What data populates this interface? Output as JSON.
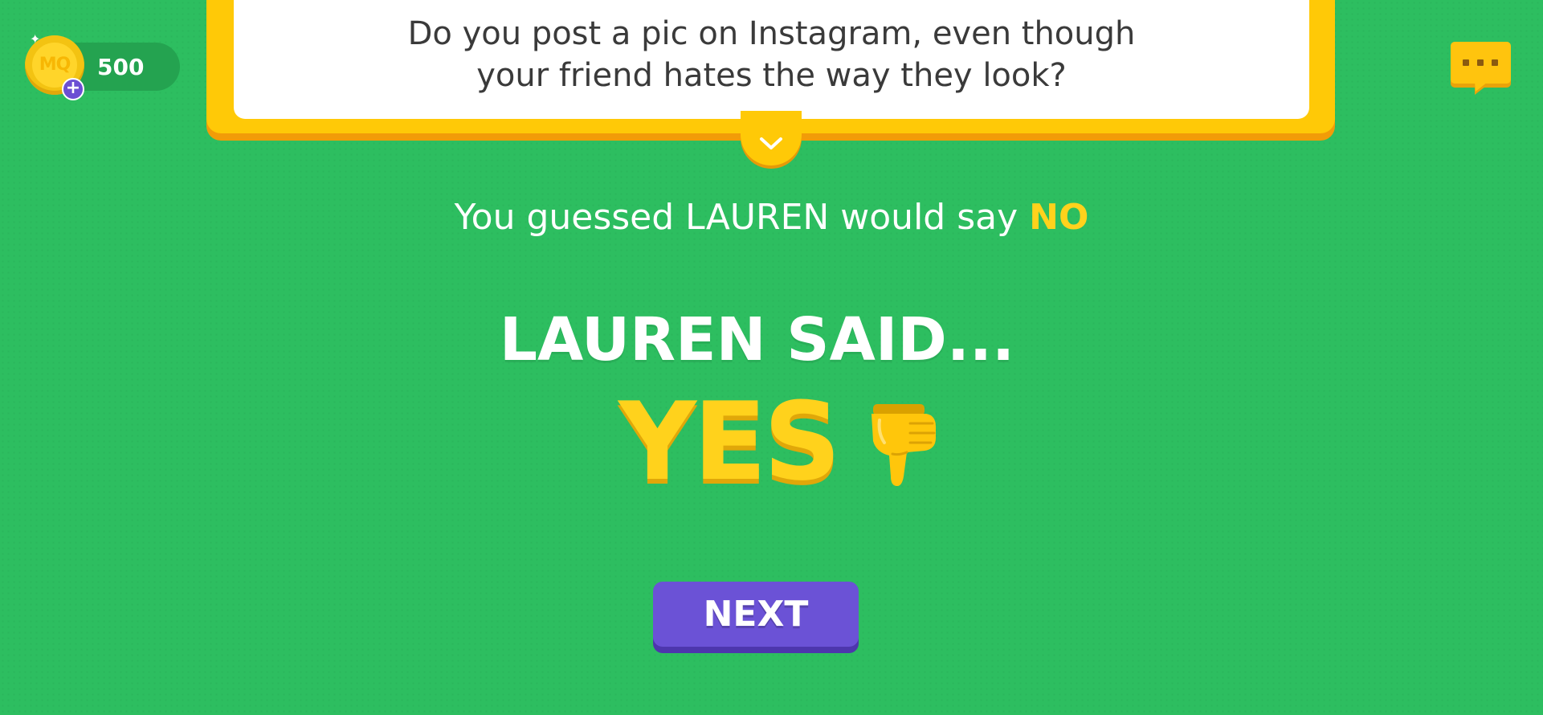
{
  "wallet": {
    "coin_label": "MQ",
    "coin_count": "500",
    "add_icon": "plus-icon"
  },
  "chat": {
    "icon": "chat-bubble-icon"
  },
  "question": {
    "text": "Do you post a pic on Instagram, even though your friend hates the way they look?",
    "expand_icon": "chevron-down-icon"
  },
  "result": {
    "guess_prefix": "You guessed LAUREN would say ",
    "guess_answer": "NO",
    "said_heading": "LAUREN SAID...",
    "actual_answer": "YES",
    "outcome_icon": "thumbs-down-icon"
  },
  "actions": {
    "next_label": "NEXT"
  },
  "colors": {
    "background": "#2dbe60",
    "card_frame": "#ffc907",
    "answer_yellow": "#ffd21c",
    "button_purple": "#6b52d6"
  }
}
